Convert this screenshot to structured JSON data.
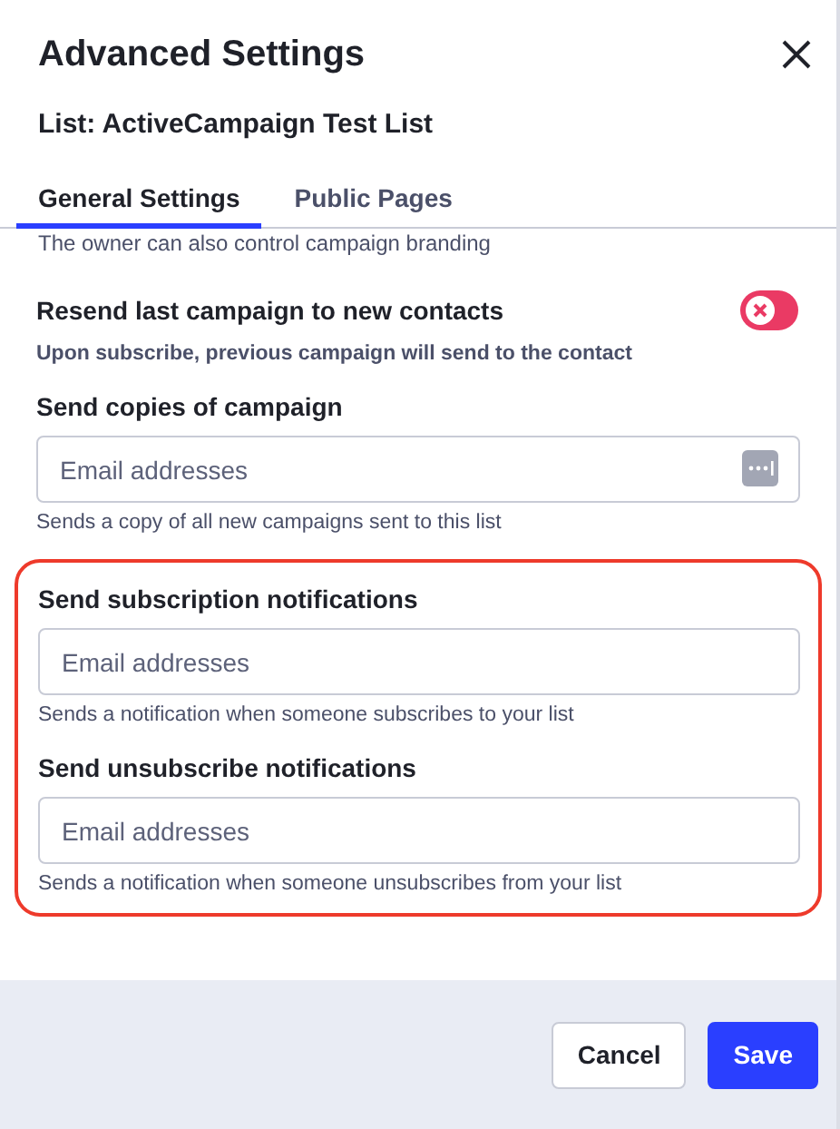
{
  "dialog": {
    "title": "Advanced Settings",
    "subtitle": "List: ActiveCampaign Test List"
  },
  "tabs": [
    {
      "label": "General Settings",
      "selected": true
    },
    {
      "label": "Public Pages",
      "selected": false
    }
  ],
  "clipped_text": "The owner can also control campaign branding",
  "settings": [
    {
      "kind": "toggle",
      "label": "Resend last campaign to new contacts",
      "description": "Upon subscribe, previous campaign will send to the contact",
      "on": false,
      "highlighted": false
    },
    {
      "kind": "field",
      "label": "Send copies of campaign",
      "placeholder": "Email addresses",
      "description": "Sends a copy of all new campaigns sent to this list",
      "has_menu": true,
      "highlighted": false
    },
    {
      "kind": "field",
      "label": "Send subscription notifications",
      "placeholder": "Email addresses",
      "description": "Sends a notification when someone subscribes to your list",
      "has_menu": false,
      "highlighted": true
    },
    {
      "kind": "field",
      "label": "Send unsubscribe notifications",
      "placeholder": "Email addresses",
      "description": "Sends a notification when someone unsubscribes from your list",
      "has_menu": false,
      "highlighted": true
    }
  ],
  "buttons": [
    {
      "label": "Cancel",
      "kind": "secondary"
    },
    {
      "label": "Save",
      "kind": "primary"
    }
  ]
}
